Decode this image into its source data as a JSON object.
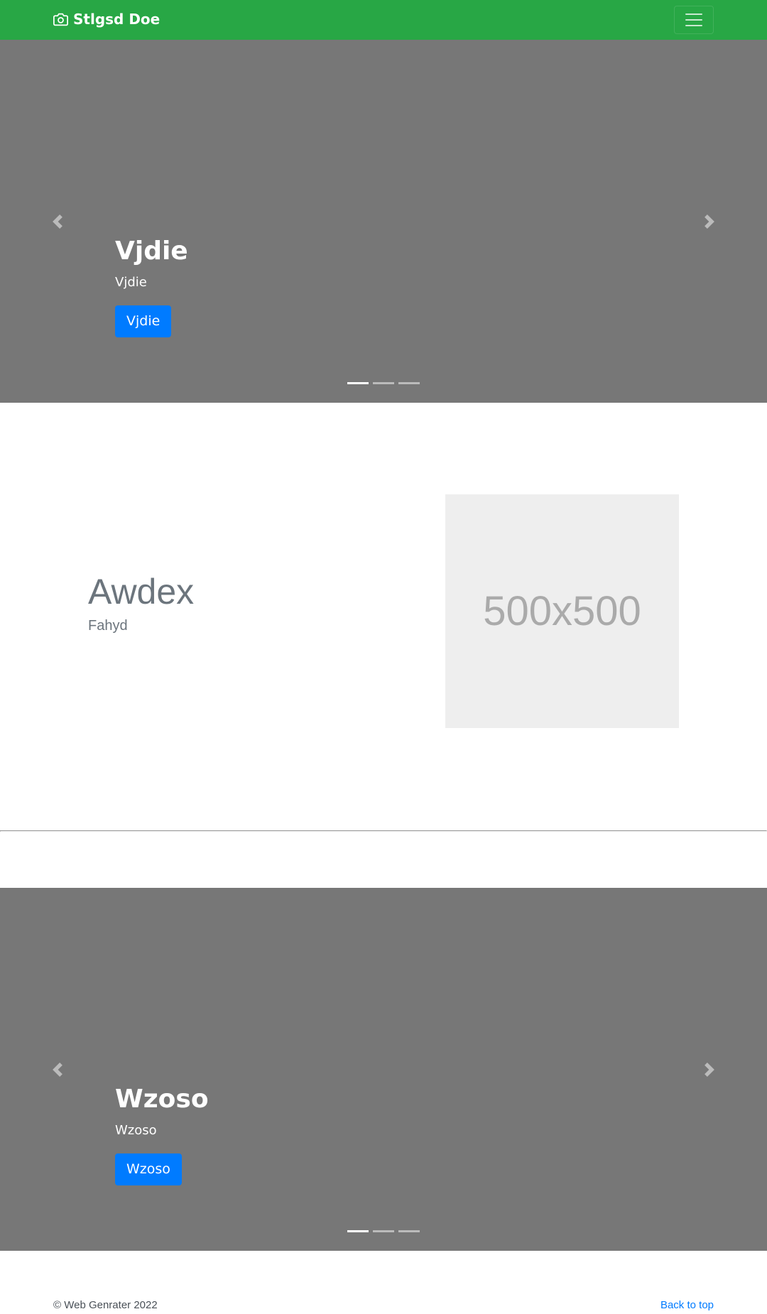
{
  "navbar": {
    "brand": "Stlgsd Doe",
    "background": "#28a745",
    "brand_icon": "camera-icon",
    "toggler_icon": "hamburger-menu-icon"
  },
  "carousel_1": {
    "title": "Vjdie",
    "subtitle": "Vjdie",
    "button_label": "Vjdie",
    "background": "#777777",
    "prev_icon": "chevron-left-icon",
    "next_icon": "chevron-right-icon",
    "slide_count": 3,
    "active_slide": 1
  },
  "featurette": {
    "heading": "Awdex",
    "text": "Fahyd",
    "image_label": "500x500"
  },
  "carousel_2": {
    "title": "Wzoso",
    "subtitle": "Wzoso",
    "button_label": "Wzoso",
    "background": "#777777",
    "prev_icon": "chevron-left-icon",
    "next_icon": "chevron-right-icon",
    "slide_count": 3,
    "active_slide": 1
  },
  "footer": {
    "copyright": "© Web Genrater 2022",
    "back_to_top": "Back to top"
  },
  "colors": {
    "primary": "#007bff",
    "muted": "#6c757d"
  }
}
